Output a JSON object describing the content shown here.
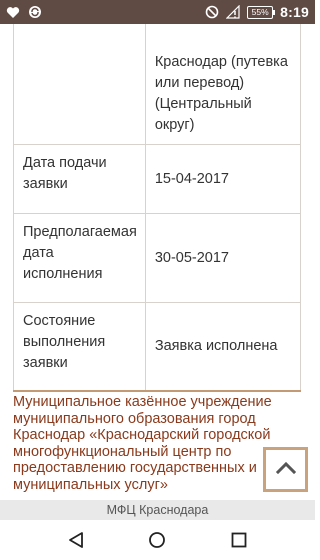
{
  "status_bar": {
    "time": "8:19",
    "battery": "55%",
    "icons": [
      "heart-icon",
      "sync-icon",
      "do-not-disturb-icon",
      "signal-icon",
      "battery-icon"
    ]
  },
  "table": {
    "rows": [
      {
        "label": "",
        "value": "Краснодар (путевка или перевод) (Центральный округ)"
      },
      {
        "label": "Дата подачи заявки",
        "value": "15-04-2017"
      },
      {
        "label": "Предполагаемая дата исполнения",
        "value": "30-05-2017"
      },
      {
        "label": "Состояние выполнения заявки",
        "value": "Заявка исполнена"
      }
    ]
  },
  "footer": {
    "text": "Муниципальное казённое учреждение муниципального образования город Краснодар «Краснодарский городской многофункциональный центр по предоставлению государственных и муниципальных услуг»"
  },
  "bottom_label": "МФЦ Краснодара",
  "colors": {
    "status_bar": "#5f4a44",
    "accent": "#c49a74",
    "footer_text": "#8a3a1c",
    "border": "#d9d2cc"
  }
}
